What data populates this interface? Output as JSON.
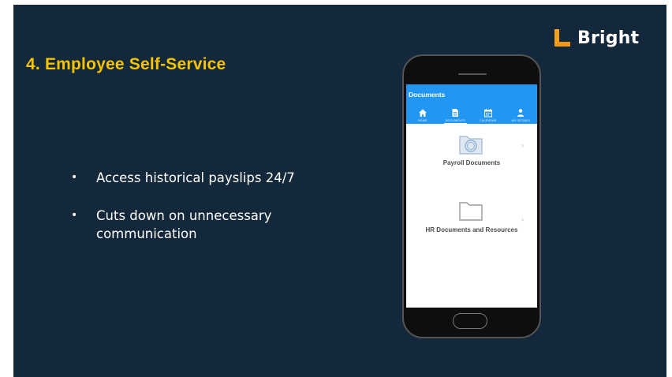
{
  "slide": {
    "title": "4. Employee Self-Service",
    "brand": {
      "name": "Bright",
      "colors": {
        "left": "#f7a21b",
        "right": "#2d9cdb"
      }
    },
    "bullets": [
      "Access historical payslips 24/7",
      "Cuts down on unnecessary communication"
    ],
    "bullet_char": "•",
    "colors": {
      "background": "#13283a",
      "title": "#f5c400",
      "text": "#ffffff"
    }
  },
  "phone": {
    "app_title": "Documents",
    "accent": "#2196f3",
    "tabs": [
      {
        "label": "HOME",
        "icon": "home-icon"
      },
      {
        "label": "DOCUMENTS",
        "icon": "document-icon",
        "active": true
      },
      {
        "label": "CALENDAR",
        "icon": "calendar-icon"
      },
      {
        "label": "MY DETAILS",
        "icon": "person-icon"
      }
    ],
    "folders": [
      {
        "label": "Payroll Documents",
        "icon": "payroll-folder-icon"
      },
      {
        "label": "HR Documents and Resources",
        "icon": "folder-icon"
      }
    ],
    "chevron": "›"
  }
}
